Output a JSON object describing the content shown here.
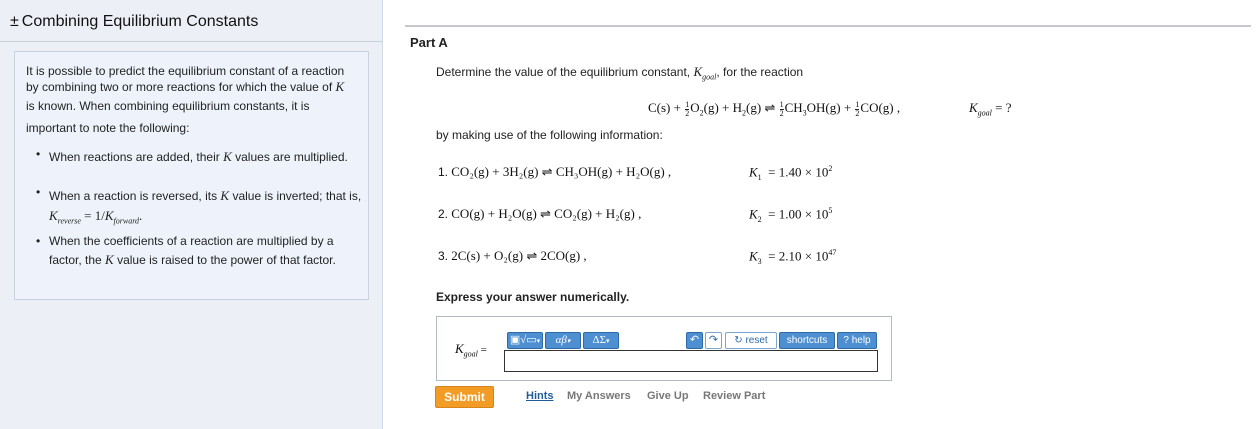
{
  "sidebar": {
    "title_symbol": "±",
    "title": "Combining Equilibrium Constants",
    "intro_1": "It is possible to predict the equilibrium constant of a reaction by combining two or more reactions for which the value of",
    "intro_K": "K",
    "intro_2": "is known. When combining equilibrium constants, it is important to note the following:",
    "bullets": [
      {
        "before": "When reactions are added, their",
        "K": "K",
        "after": "values are multiplied."
      },
      {
        "before": "When a reaction is reversed, its",
        "K": "K",
        "after": "value is inverted; that is,",
        "formula": "K",
        "sub1": "reverse",
        "mid": " = 1/",
        "sub2": "forward",
        "end": "."
      },
      {
        "before": "When the coefficients of a reaction are multiplied by a factor, the",
        "K": "K",
        "after": "value is raised to the power of that factor."
      }
    ]
  },
  "main": {
    "part_label": "Part A",
    "question_1": "Determine the value of the equilibrium constant,",
    "question_K": "K",
    "question_sub": "goal",
    "question_2": ", for the reaction",
    "goal_reaction": {
      "left": "C(s) + ",
      "o2": "O",
      "o2_tail": "(g) + H",
      "h2_tail": "(g) ⇌ ",
      "ch3oh": "CH",
      "ch3oh_tail": "OH(g) + ",
      "co": "CO(g) ,",
      "half_num": "1",
      "half_den": "2",
      "sub_2": "2",
      "sub_3": "3"
    },
    "goal_k": {
      "K": "K",
      "sub": "goal",
      "rest": " = ?"
    },
    "info": "by making use of the following information:",
    "reactions": [
      {
        "n": "1.",
        "eq": "CO₂(g) + 3H₂(g) ⇌ CH₃OH(g) + H₂O(g) ,",
        "K": "K",
        "ksub": "1",
        "mantissa": "= 1.40 × 10",
        "exp": "2"
      },
      {
        "n": "2.",
        "eq": "CO(g) + H₂O(g) ⇌ CO₂(g) + H₂(g) ,",
        "K": "K",
        "ksub": "2",
        "mantissa": "= 1.00 × 10",
        "exp": "5"
      },
      {
        "n": "3.",
        "eq": "2C(s) + O₂(g) ⇌ 2CO(g) ,",
        "K": "K",
        "ksub": "3",
        "mantissa": "= 2.10 × 10",
        "exp": "47"
      }
    ],
    "express": "Express your answer numerically.",
    "answer_label_K": "K",
    "answer_label_sub": "goal",
    "answer_label_eq": " =",
    "answer_value": "",
    "toolbar": {
      "templates": "▣√▭",
      "greek": "αβ",
      "delta": "ΔΣ",
      "caret": "▾",
      "undo": "↶",
      "redo": "↷",
      "reset": "↻ reset",
      "shortcuts": "shortcuts",
      "help": "? help"
    },
    "submit": "Submit",
    "links": [
      "Hints",
      "My Answers",
      "Give Up",
      "Review Part"
    ]
  }
}
